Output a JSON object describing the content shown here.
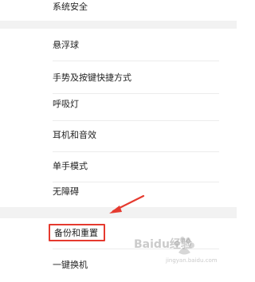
{
  "settings": {
    "items": [
      {
        "label": "系统安全"
      },
      {
        "label": "悬浮球"
      },
      {
        "label": "手势及按键快捷方式"
      },
      {
        "label": "呼吸灯"
      },
      {
        "label": "耳机和音效"
      },
      {
        "label": "单手模式"
      },
      {
        "label": "无障碍"
      },
      {
        "label": "备份和重置"
      },
      {
        "label": "一键换机"
      }
    ]
  },
  "colors": {
    "highlight": "#e53a2f",
    "background": "#f4f4f4",
    "text": "#222222"
  },
  "watermark": {
    "text": "Baidu经验",
    "subtext": "jingyan.baidu.com"
  }
}
